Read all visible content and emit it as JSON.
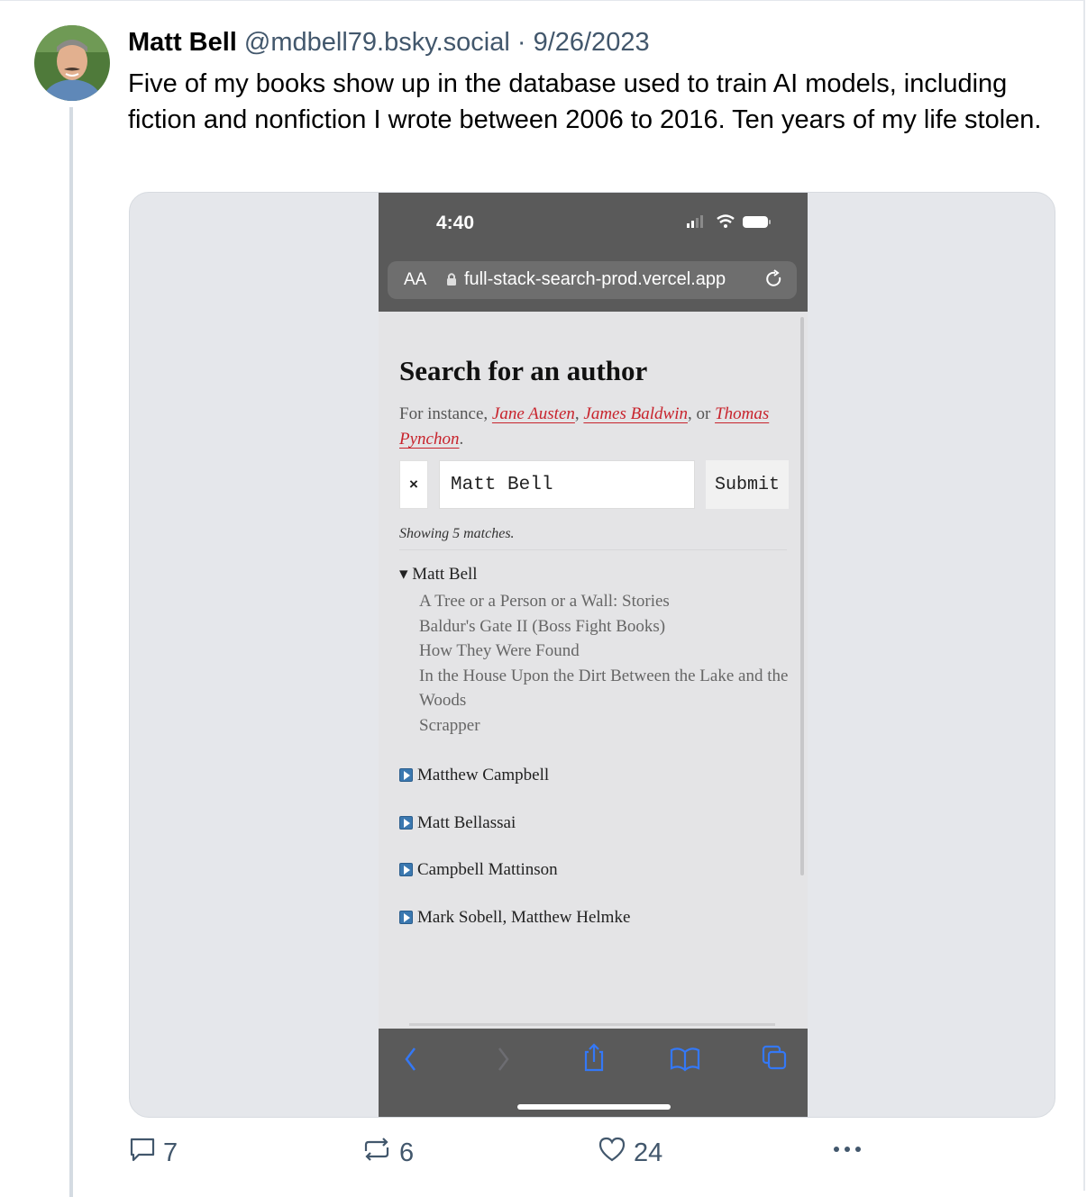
{
  "post": {
    "author_name": "Matt Bell",
    "handle": "@mdbell79.bsky.social",
    "separator": "·",
    "date": "9/26/2023",
    "text": "Five of my books show up in the database used to train AI models, including fiction and nonfiction I wrote between 2006 to 2016. Ten years of my life stolen."
  },
  "screenshot": {
    "status_time": "4:40",
    "aa_label": "AA",
    "url": "full-stack-search-prod.vercel.app",
    "heading": "Search for an author",
    "instance_prefix": "For instance,",
    "example_1": "Jane Austen",
    "example_2": "James Baldwin",
    "or_word": "or",
    "example_3": "Thomas Pynchon",
    "clear_label": "×",
    "search_value": "Matt Bell",
    "submit_label": "Submit",
    "showing_text": "Showing 5 matches.",
    "open_author": "▾ Matt Bell",
    "books": [
      "A Tree or a Person or a Wall: Stories",
      "Baldur's Gate II (Boss Fight Books)",
      "How They Were Found",
      "In the House Upon the Dirt Between the Lake and the Woods",
      "Scrapper"
    ],
    "other_authors": [
      "Matthew Campbell",
      "Matt Bellassai",
      "Campbell Mattinson",
      "Mark Sobell, Matthew Helmke"
    ]
  },
  "actions": {
    "replies": "7",
    "reposts": "6",
    "likes": "24"
  },
  "colors": {
    "muted": "#42576c",
    "link_red": "#c8232c",
    "browser_chrome": "#5a5a5a",
    "ios_blue": "#3478f6"
  }
}
